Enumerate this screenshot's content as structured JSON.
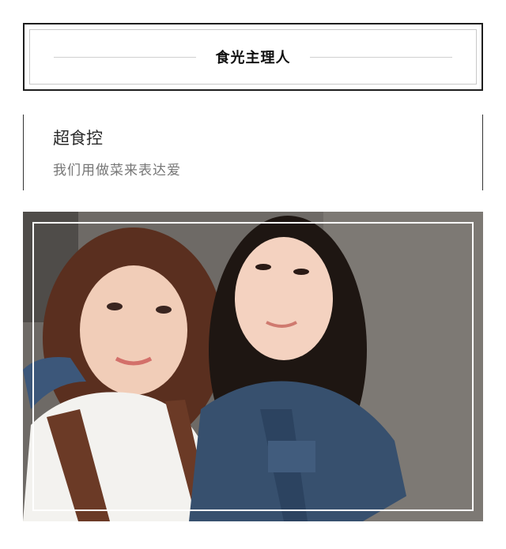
{
  "header": {
    "title": "食光主理人"
  },
  "profile": {
    "name": "超食控",
    "tagline": "我们用做菜来表达爱"
  },
  "photo": {
    "icon": "portrait-photo-icon"
  }
}
